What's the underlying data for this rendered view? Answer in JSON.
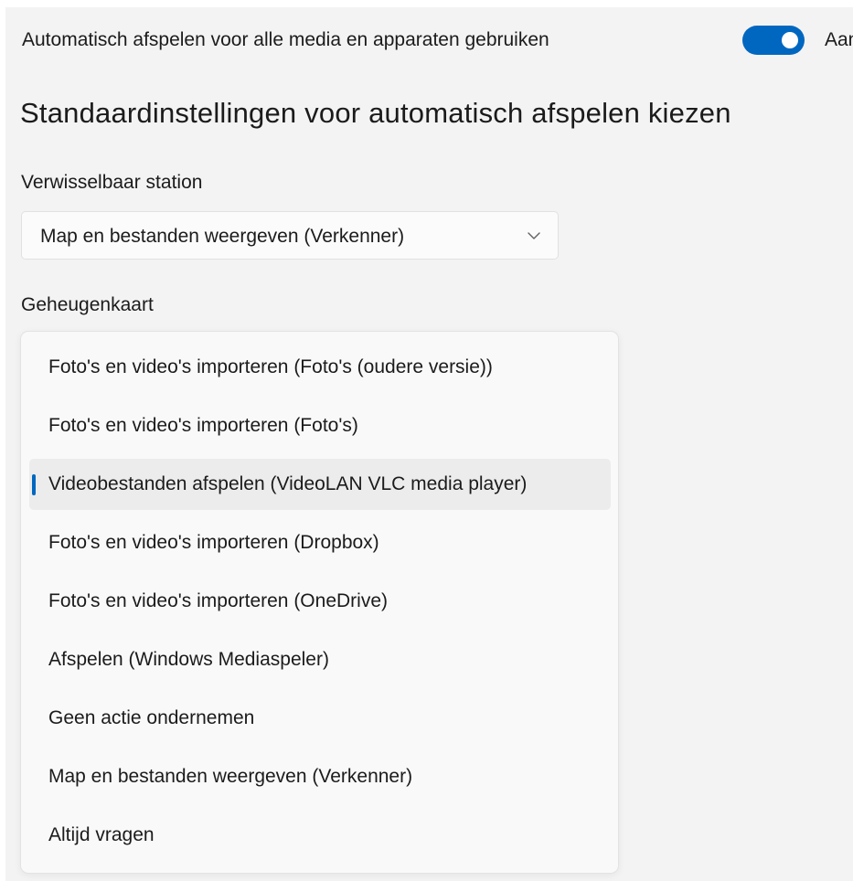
{
  "autoplay": {
    "label": "Automatisch afspelen voor alle media en apparaten gebruiken",
    "state": "Aan",
    "enabled": true,
    "accent": "#0067c0"
  },
  "section_title": "Standaardinstellingen voor automatisch afspelen kiezen",
  "removable_drive": {
    "label": "Verwisselbaar station",
    "selected": "Map en bestanden weergeven (Verkenner)"
  },
  "memory_card": {
    "label": "Geheugenkaart",
    "options": [
      "Foto's en video's importeren (Foto's (oudere versie))",
      "Foto's en video's importeren (Foto's)",
      "Videobestanden afspelen (VideoLAN VLC media player)",
      "Foto's en video's importeren (Dropbox)",
      "Foto's en video's importeren (OneDrive)",
      "Afspelen (Windows Mediaspeler)",
      "Geen actie ondernemen",
      "Map en bestanden weergeven (Verkenner)",
      "Altijd vragen"
    ],
    "selected_index": 2
  },
  "icons": {
    "dropdown": "chevron-down-icon"
  }
}
